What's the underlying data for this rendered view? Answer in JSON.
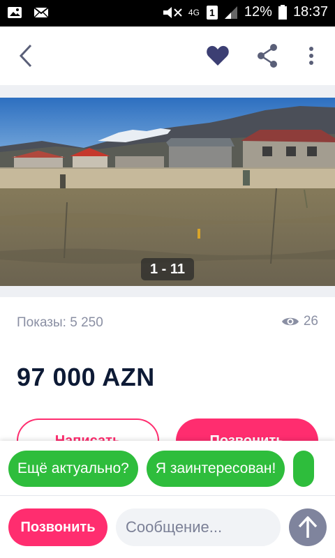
{
  "status_bar": {
    "network": "4G",
    "sim_slot": "1",
    "battery": "12%",
    "time": "18:37",
    "icons": [
      "gallery-icon",
      "mail-icon",
      "mute-icon",
      "signal-icon",
      "battery-icon"
    ]
  },
  "app_bar": {
    "icons": [
      "back-arrow-icon",
      "heart-icon",
      "share-icon",
      "more-vertical-icon"
    ]
  },
  "gallery": {
    "counter": "1 - 11"
  },
  "stats": {
    "impressions": "Показы: 5 250",
    "views": "26"
  },
  "listing": {
    "price": "97 000 AZN"
  },
  "actions": {
    "write_label": "Написать",
    "call_label": "Позвонить"
  },
  "quick_replies": [
    "Ещё актуально?",
    "Я заинтересован!"
  ],
  "bottom_bar": {
    "call_label": "Позвонить",
    "message_placeholder": "Сообщение..."
  },
  "colors": {
    "accent_pink": "#ff2d6f",
    "chip_green": "#2ebd3c",
    "heart_blue": "#3c3f73",
    "send_gray": "#7f849d",
    "price_dark": "#0d1a35"
  }
}
